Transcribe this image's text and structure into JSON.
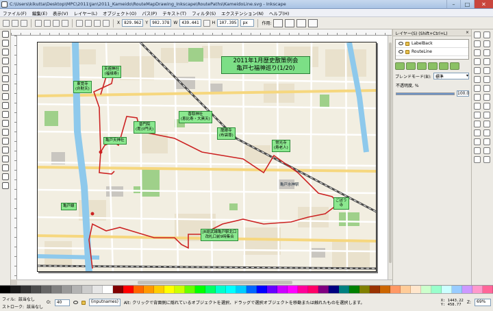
{
  "window": {
    "title": "C:\\Users\\kikutta\\Desktop\\MPC\\2011\\Jan\\2011_Kameido\\RouteMapDrawing_Inkscape\\RoutePaths\\KameidoLine.svg - Inkscape",
    "controls": [
      "–",
      "□",
      "✕"
    ]
  },
  "menu": [
    "ファイル(F)",
    "編集(E)",
    "表示(V)",
    "レイヤー(L)",
    "オブジェクト(O)",
    "パス(P)",
    "テキスト(T)",
    "フィルタ(S)",
    "エクステンション(N)",
    "ヘルプ(H)"
  ],
  "toolbar": {
    "x_label": "X",
    "x_value": "829.962",
    "y_label": "Y",
    "y_value": "902.378",
    "w_label": "W",
    "w_value": "439.441",
    "h_label": "H",
    "h_value": "107.395",
    "unit": "px",
    "affect_label": "作用:"
  },
  "map": {
    "title_line1": "2011年1月歴史散策例会",
    "title_line2": "亀戸七福神巡り(1/20)",
    "labels": [
      {
        "name": "tenjin",
        "text": "天祖神社\n(福禄寿)"
      },
      {
        "name": "tokoin",
        "text": "東覚寺\n(弁財天)"
      },
      {
        "name": "katori",
        "text": "香取神社\n(恵比寿・大黒天)"
      },
      {
        "name": "kozenin",
        "text": "普門院\n(毘沙門天)"
      },
      {
        "name": "jokoji",
        "text": "常光寺\n(寿老人)"
      },
      {
        "name": "kameido-tenjin",
        "text": "亀戸天神社"
      },
      {
        "name": "kameido-station",
        "text": "JR総武線亀戸駅北口\n改札口前9時集合"
      },
      {
        "name": "kameido-line",
        "text": "亀戸線"
      },
      {
        "name": "goal",
        "text": "ごぼう\n寺"
      },
      {
        "name": "kameido-suijinmae",
        "text": "亀戸水神駅"
      },
      {
        "name": "shrine-temple",
        "text": "龍眼寺\n(布袋尊)"
      }
    ]
  },
  "layers": {
    "panel_title": "レイヤー(S) (Shift+Ctrl+L)",
    "items": [
      {
        "label": "LabelBack"
      },
      {
        "label": "RouteLine"
      }
    ],
    "blend_label": "ブレンドモード(B):",
    "blend_value": "標準",
    "opacity_label": "不透明度, %",
    "opacity_value": "100.0",
    "opacity_fraction": 1.0
  },
  "status": {
    "fill_label": "フィル:",
    "fill_value": "該当なし",
    "stroke_label": "ストローク:",
    "stroke_value": "該当なし",
    "o_label": "O:",
    "o_value": "40",
    "layer_value": "(inputnames)",
    "message": "Alt: クリックで背面側に隠れているオブジェクトを選択、ドラッグで選択オブジェクトを移動または触れたものを選択します。",
    "x_coord": "X: 1443.22",
    "y_coord": "Y: 458.77",
    "z_label": "Z:",
    "zoom": "69%"
  },
  "palette": [
    "#000000",
    "#1a1a1a",
    "#333333",
    "#4d4d4d",
    "#666666",
    "#808080",
    "#999999",
    "#b3b3b3",
    "#cccccc",
    "#e6e6e6",
    "#ffffff",
    "#800000",
    "#ff0000",
    "#ff6600",
    "#ff9900",
    "#ffcc00",
    "#ffff00",
    "#ccff00",
    "#66ff00",
    "#00ff00",
    "#00ff66",
    "#00ffcc",
    "#00ffff",
    "#00ccff",
    "#0066ff",
    "#0000ff",
    "#6600ff",
    "#cc00ff",
    "#ff00ff",
    "#ff0099",
    "#ff0066",
    "#800080",
    "#000080",
    "#008080",
    "#008000",
    "#808000",
    "#993300",
    "#cc6600",
    "#ff9966",
    "#ffcc99",
    "#ffe6cc",
    "#ccffcc",
    "#99ffcc",
    "#ccffff",
    "#99ccff",
    "#cc99ff",
    "#ff99cc",
    "#ff6699"
  ]
}
